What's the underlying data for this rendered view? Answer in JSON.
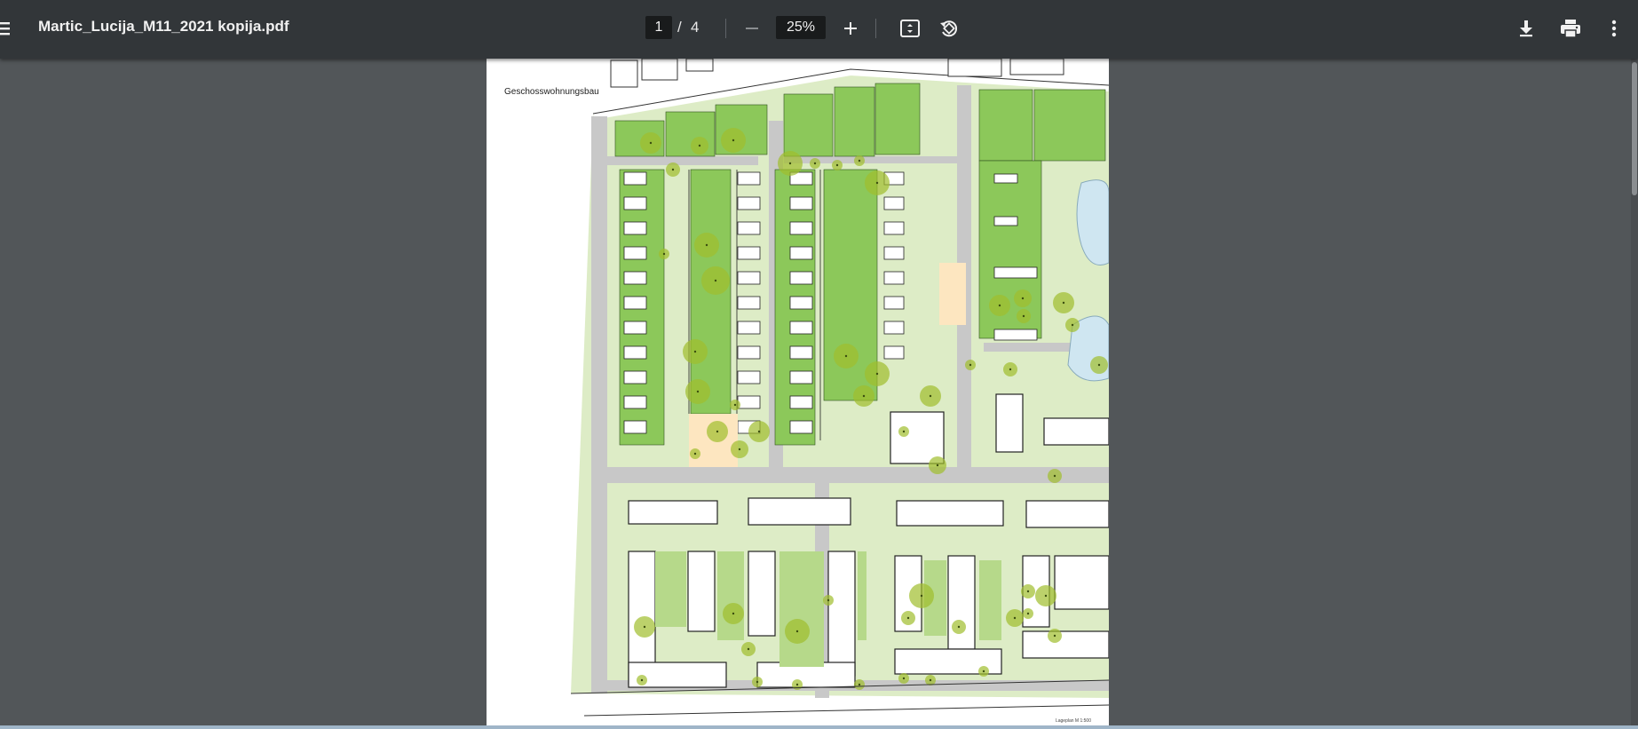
{
  "viewer": {
    "title": "Martic_Lucija_M11_2021 kopija.pdf",
    "page_current": "1",
    "page_separator": "/",
    "page_total": "4",
    "zoom": "25%",
    "icons": [
      "menu-icon",
      "zoom-out-icon",
      "zoom-in-icon",
      "fit-page-icon",
      "rotate-icon",
      "download-icon",
      "print-icon",
      "more-vert-icon"
    ]
  },
  "document": {
    "plan_label": "Geschosswohnungsbau",
    "scale_label": "Lageplan M 1:500",
    "colors": {
      "lawn": "#8cc85a",
      "lawn_light": "#ddecc6",
      "path": "#c8c8c8",
      "sand": "#fde6c0",
      "water": "#cfe6f1",
      "tree": "#9fbe2c"
    }
  }
}
